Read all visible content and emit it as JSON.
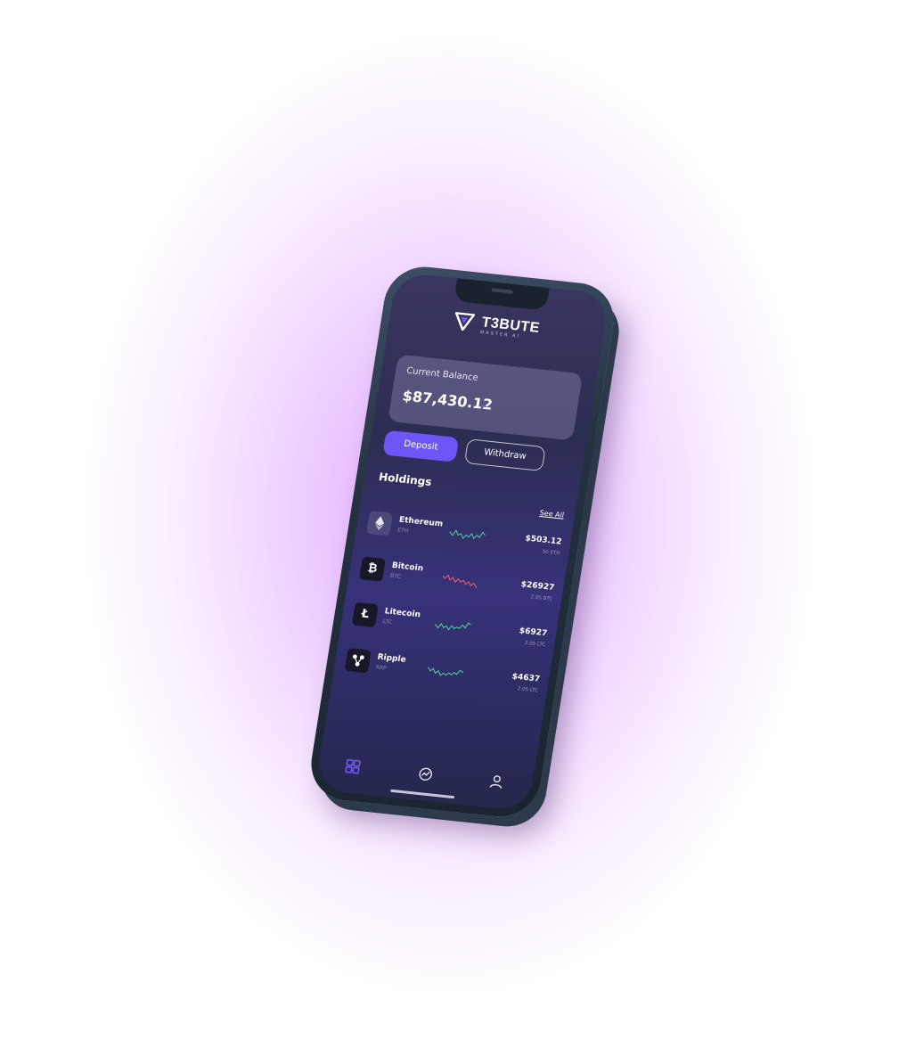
{
  "app": {
    "brand": "T3BUTE",
    "tagline": "MASTER AI"
  },
  "balance": {
    "label": "Current Balance",
    "value": "$87,430.12"
  },
  "actions": {
    "deposit_label": "Deposit",
    "withdraw_label": "Withdraw"
  },
  "holdings": {
    "title": "Holdings",
    "see_all_label": "See All",
    "items": [
      {
        "name": "Ethereum",
        "symbol": "ETH",
        "price": "$503.12",
        "amount": "50 ETH",
        "trend": "up",
        "icon": "ethereum-icon"
      },
      {
        "name": "Bitcoin",
        "symbol": "BTC",
        "price": "$26927",
        "amount": "2.05 BTC",
        "trend": "down",
        "icon": "bitcoin-icon"
      },
      {
        "name": "Litecoin",
        "symbol": "LTC",
        "price": "$6927",
        "amount": "2.05 LTC",
        "trend": "up",
        "icon": "litecoin-icon"
      },
      {
        "name": "Ripple",
        "symbol": "XRP",
        "price": "$4637",
        "amount": "2.05 LTC",
        "trend": "up",
        "icon": "ripple-icon"
      }
    ]
  },
  "nav": {
    "items": [
      {
        "icon": "dashboard-icon",
        "active": true
      },
      {
        "icon": "chart-icon",
        "active": false
      },
      {
        "icon": "profile-icon",
        "active": false
      }
    ]
  },
  "colors": {
    "accent": "#6c56f5",
    "trend_up": "#4fd39a",
    "trend_down": "#ff5a6a",
    "glow": "#c45cff"
  }
}
